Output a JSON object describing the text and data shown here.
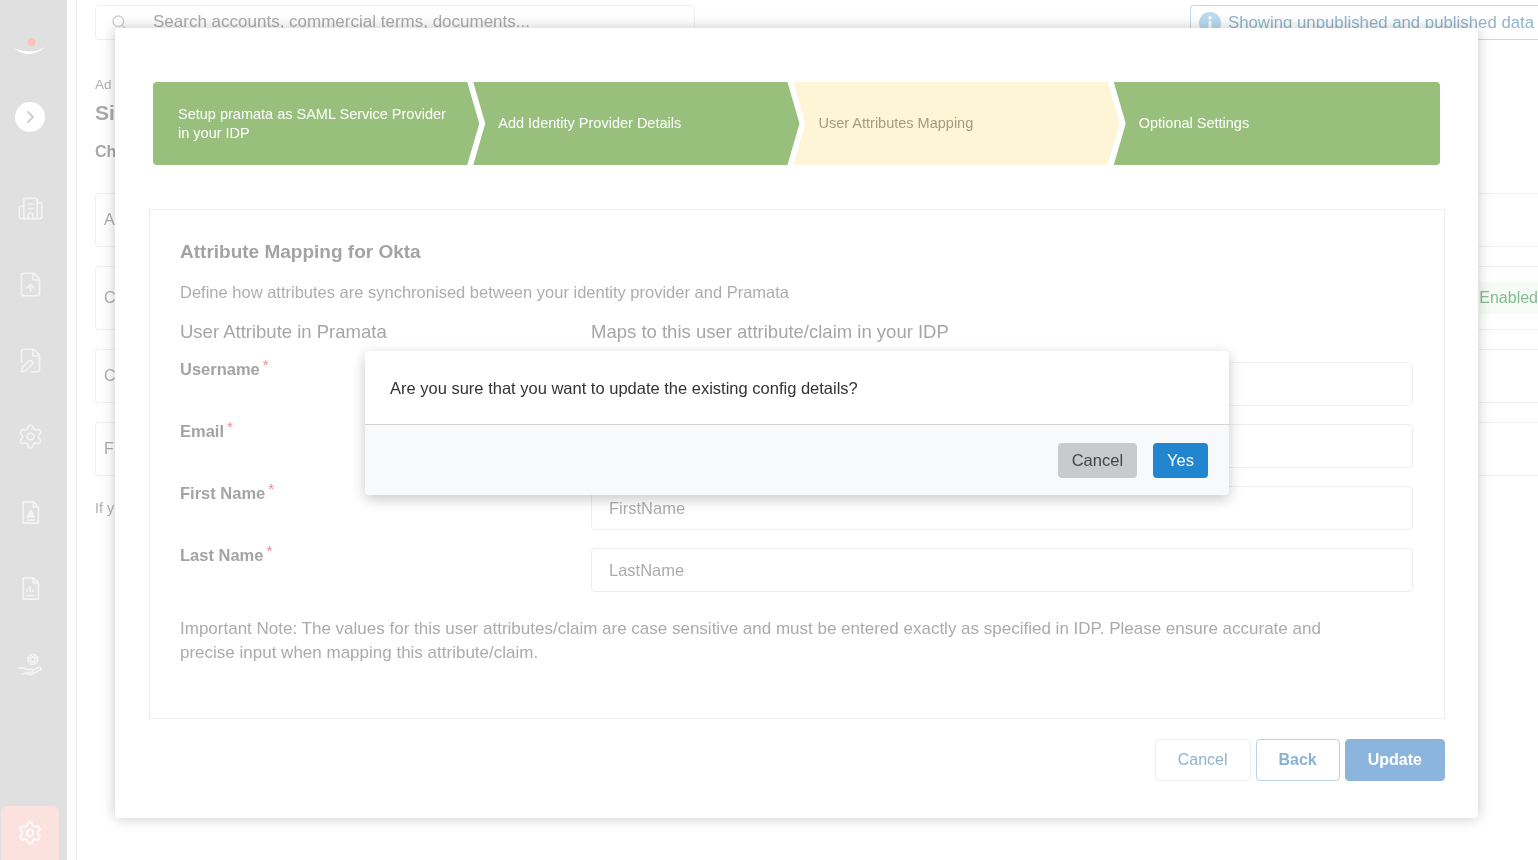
{
  "sidebar": {
    "items": [
      {
        "selected": false
      },
      {
        "selected": false
      },
      {
        "selected": false
      },
      {
        "selected": false
      },
      {
        "selected": false
      },
      {
        "selected": false
      },
      {
        "selected": false
      }
    ],
    "settings": {
      "selected": true
    }
  },
  "top_bar": {
    "search": {
      "placeholder": "Search accounts, commercial terms, documents..."
    },
    "notice": "Showing unpublished and published data"
  },
  "page": {
    "breadcrumb": "Ad",
    "title": "Si",
    "heading": "Ch",
    "cards": [
      {
        "text": "A"
      },
      {
        "text": "C",
        "badge": "Enabled"
      },
      {
        "text": "C"
      },
      {
        "text": "F"
      }
    ],
    "helper_text": "If y"
  },
  "wizard": {
    "steps": [
      {
        "label": "Setup pramata as SAML Service Provider in your IDP",
        "current": false
      },
      {
        "label": "Add Identity Provider Details",
        "current": false
      },
      {
        "label": "User Attributes Mapping",
        "current": true
      },
      {
        "label": "Optional Settings",
        "current": false
      }
    ],
    "panel": {
      "title": "Attribute Mapping for Okta",
      "description": "Define how attributes are synchronised between your identity provider and Pramata",
      "columns": [
        "User Attribute in Pramata",
        "Maps to this user attribute/claim in your IDP"
      ],
      "rows": [
        {
          "label": "Username$^{*}$"
        },
        {
          "label": "Email$^{*}$"
        },
        {
          "label": "First Name$^{*}$",
          "value": "FirstName"
        },
        {
          "label": "Last Name$^{*}$",
          "value": "LastName"
        }
      ],
      "note": "Important Note: The values for this user attributes/claim are case sensitive and must be entered exactly as specified in IDP. Please ensure accurate and precise input when mapping this attribute/claim."
    },
    "buttons": [
      {
        "label": "Cancel",
        "kind": "text"
      },
      {
        "label": "Back",
        "kind": "outline"
      },
      {
        "label": "Update",
        "kind": "primary"
      }
    ]
  },
  "dialog": {
    "message": "Are you sure that you want to update the existing config details?",
    "buttons": [
      {
        "label": "Cancel",
        "kind": "secondary"
      },
      {
        "label": "Yes",
        "kind": "primary"
      }
    ]
  }
}
